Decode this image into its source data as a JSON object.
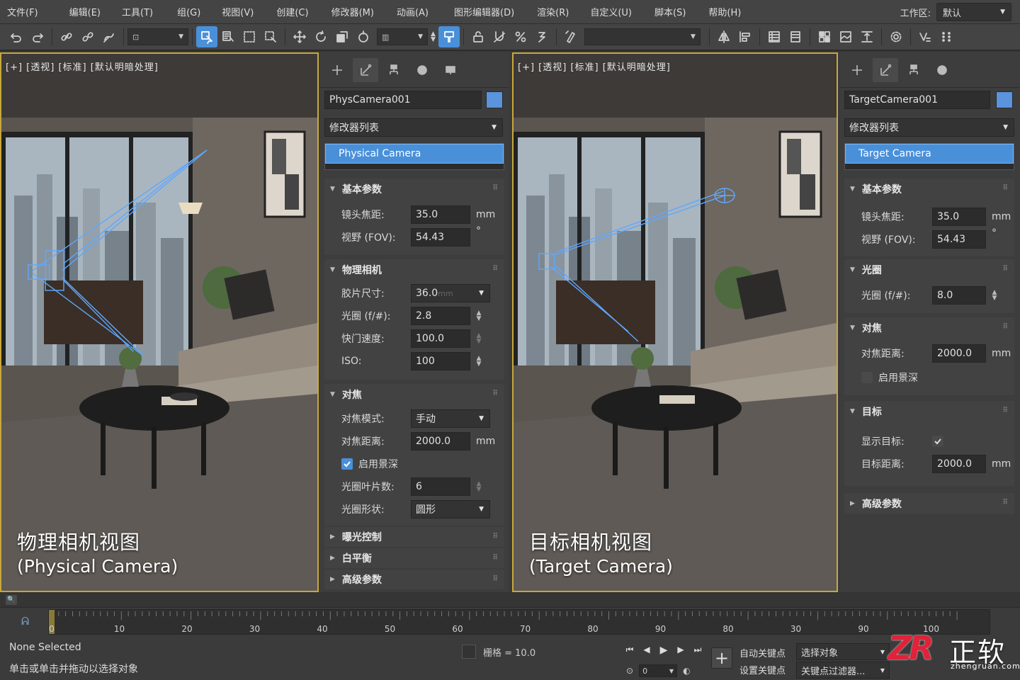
{
  "menu": [
    "文件(F)",
    "编辑(E)",
    "工具(T)",
    "组(G)",
    "视图(V)",
    "创建(C)",
    "修改器(M)",
    "动画(A)",
    "图形编辑器(D)",
    "渲染(R)",
    "自定义(U)",
    "脚本(S)",
    "帮助(H)"
  ],
  "workspace": {
    "label": "工作区:",
    "value": "默认"
  },
  "colors": {
    "accent": "#4a90d9",
    "viewport_border": "#c8a83c",
    "object_color": "#5b93dc",
    "logo_red": "#e0223a"
  },
  "viewport_left": {
    "label": "[+] [透视] [标准] [默认明暗处理]",
    "caption_main": "物理相机视图",
    "caption_sub": "(Physical Camera)"
  },
  "viewport_right": {
    "label": "[+] [透视] [标准] [默认明暗处理]",
    "caption_main": "目标相机视图",
    "caption_sub": "(Target Camera)"
  },
  "panel_left": {
    "object_name": "PhysCamera001",
    "modifier_list": "修改器列表",
    "stack_item": "Physical Camera",
    "basic": {
      "title": "基本参数",
      "focal_label": "镜头焦距:",
      "focal_value": "35.0",
      "focal_unit": "mm",
      "fov_label": "视野 (FOV):",
      "fov_value": "54.43",
      "fov_unit": "°"
    },
    "physical": {
      "title": "物理相机",
      "film_label": "胶片尺寸:",
      "film_value": "36.0",
      "film_unit_ghost": "mm",
      "aperture_label": "光圈 (f/#):",
      "aperture_value": "2.8",
      "shutter_label": "快门速度:",
      "shutter_value": "100.0",
      "iso_label": "ISO:",
      "iso_value": "100"
    },
    "focus": {
      "title": "对焦",
      "mode_label": "对焦模式:",
      "mode_value": "手动",
      "distance_label": "对焦距离:",
      "distance_value": "2000.0",
      "distance_unit": "mm",
      "dof_label": "启用景深",
      "dof_checked": true,
      "blades_label": "光圈叶片数:",
      "blades_value": "6",
      "shape_label": "光圈形状:",
      "shape_value": "圆形"
    },
    "collapsed": [
      "曝光控制",
      "白平衡",
      "高级参数"
    ]
  },
  "panel_right": {
    "object_name": "TargetCamera001",
    "modifier_list": "修改器列表",
    "stack_item": "Target Camera",
    "basic": {
      "title": "基本参数",
      "focal_label": "镜头焦距:",
      "focal_value": "35.0",
      "focal_unit": "mm",
      "fov_label": "视野 (FOV):",
      "fov_value": "54.43",
      "fov_unit": "°"
    },
    "aperture": {
      "title": "光圈",
      "label": "光圈 (f/#):",
      "value": "8.0"
    },
    "focus": {
      "title": "对焦",
      "distance_label": "对焦距离:",
      "distance_value": "2000.0",
      "distance_unit": "mm",
      "dof_label": "启用景深",
      "dof_checked": false
    },
    "target": {
      "title": "目标",
      "show_label": "显示目标:",
      "show_checked": true,
      "distance_label": "目标距离:",
      "distance_value": "2000.0",
      "distance_unit": "mm"
    },
    "collapsed": [
      "高级参数"
    ]
  },
  "timeline": {
    "ticks": [
      "0",
      "10",
      "20",
      "30",
      "40",
      "50",
      "60",
      "70",
      "80",
      "90",
      "80",
      "30",
      "90",
      "100"
    ],
    "current_frame": "0"
  },
  "status": {
    "selection": "None Selected",
    "hint": "单击或单击并拖动以选择对象",
    "grid": "栅格 = 10.0"
  },
  "keys": {
    "auto_key": "自动关键点",
    "set_key": "设置关键点",
    "select_object": "选择对象",
    "key_filter": "关键点过滤器..."
  },
  "logo": {
    "mark": "ZR",
    "name": "正软",
    "url": "zhengruan.com"
  }
}
